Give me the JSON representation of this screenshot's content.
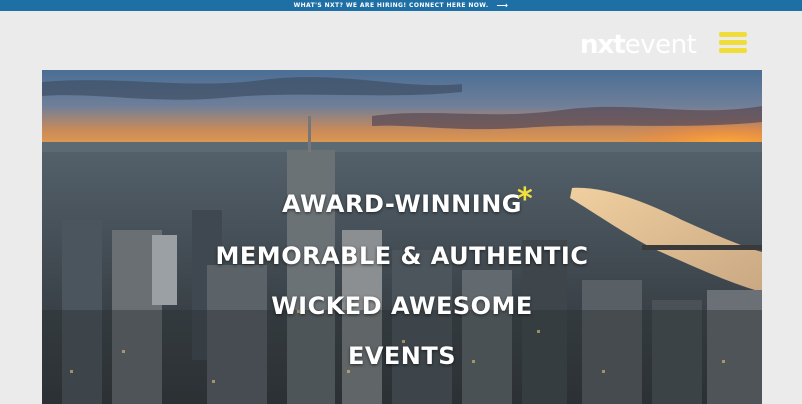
{
  "announcement": {
    "text": "WHAT'S NXT? WE ARE HIRING! CONNECT HERE NOW.",
    "arrow_icon": "arrow-right-icon"
  },
  "logo": {
    "part1": "nxt",
    "part2": "event"
  },
  "menu": {
    "icon": "hamburger-menu-icon",
    "color": "#f0dd3a"
  },
  "hero": {
    "lines": [
      "AWARD-WINNING",
      "MEMORABLE & AUTHENTIC",
      "WICKED AWESOME",
      "EVENTS"
    ],
    "accent_star": "*"
  },
  "colors": {
    "topbar": "#1e6fa6",
    "background": "#ebebeb",
    "accent": "#f2e13a"
  }
}
